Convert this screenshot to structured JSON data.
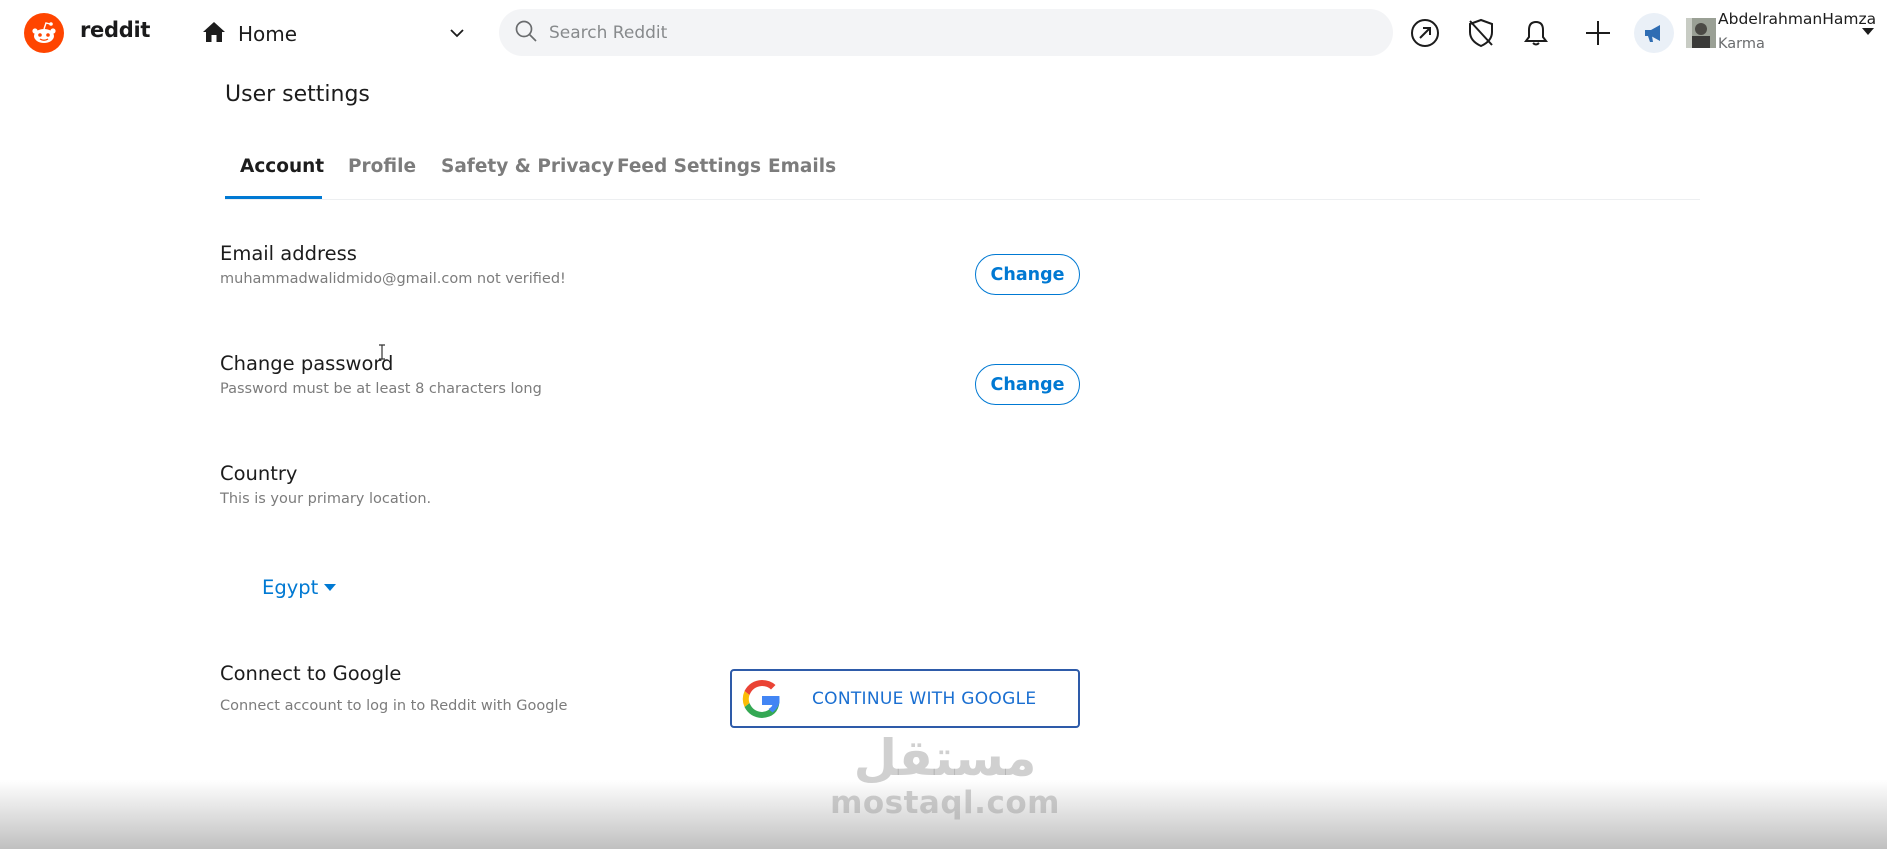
{
  "header": {
    "brand": "reddit",
    "home_label": "Home",
    "search_placeholder": "Search Reddit",
    "icons": [
      "popular-icon",
      "mod-shield-icon",
      "notifications-bell-icon",
      "create-post-plus-icon",
      "advertise-megaphone-icon"
    ],
    "user": {
      "name": "AbdelrahmanHamza",
      "karma_label": "Karma"
    }
  },
  "page": {
    "title": "User settings"
  },
  "tabs": [
    {
      "label": "Account",
      "active": true
    },
    {
      "label": "Profile"
    },
    {
      "label": "Safety & Privacy"
    },
    {
      "label": "Feed Settings"
    },
    {
      "label": "Emails"
    }
  ],
  "settings": {
    "email": {
      "title": "Email address",
      "description": "muhammadwalidmido@gmail.com not verified!",
      "button": "Change"
    },
    "password": {
      "title": "Change password",
      "description": "Password must be at least 8 characters long",
      "button": "Change"
    },
    "country": {
      "title": "Country",
      "description": "This is your primary location.",
      "selected": "Egypt"
    },
    "google": {
      "title": "Connect to Google",
      "description": "Connect account to log in to Reddit with Google",
      "button": "CONTINUE WITH GOOGLE"
    }
  },
  "watermark": {
    "arabic": "مستقل",
    "latin": "mostaql.com"
  },
  "colors": {
    "brand": "#ff4500",
    "accent": "#0079d3",
    "google_border": "#2e5ba9"
  }
}
